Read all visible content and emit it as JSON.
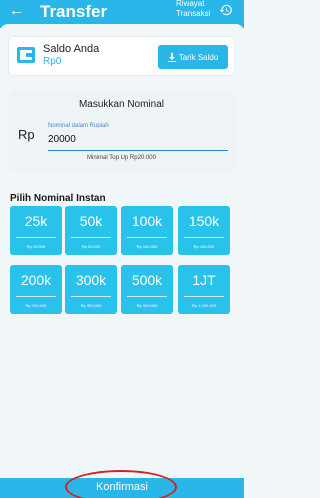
{
  "header": {
    "title": "Transfer",
    "history_label": "Riwayat\nTransaksi"
  },
  "saldo": {
    "label": "Saldo Anda",
    "value": "Rp0",
    "withdraw_button": "Tarik Saldo"
  },
  "nominal": {
    "title": "Masukkan Nominal",
    "currency": "Rp",
    "field_label": "Nominal dalam Rupiah",
    "field_value": "20000",
    "min_note": "Minimal Top Up Rp20.000"
  },
  "instant": {
    "title": "Pilih Nominal Instan",
    "tiles": [
      {
        "label": "25k",
        "amount": "Rp 25.000"
      },
      {
        "label": "50k",
        "amount": "Rp 50.000"
      },
      {
        "label": "100k",
        "amount": "Rp 100.000"
      },
      {
        "label": "150k",
        "amount": "Rp 150.000"
      },
      {
        "label": "200k",
        "amount": "Rp 200.000"
      },
      {
        "label": "300k",
        "amount": "Rp 300.000"
      },
      {
        "label": "500k",
        "amount": "Rp 500.000"
      },
      {
        "label": "1JT",
        "amount": "Rp 1.000.000"
      }
    ]
  },
  "confirm_button": "Konfirmasi",
  "colors": {
    "primary": "#29b6e8",
    "tile": "#29c2ea",
    "highlight": "#d2232a"
  },
  "icons": {
    "back": "back-arrow-icon",
    "history": "history-icon",
    "wallet": "wallet-icon",
    "download": "download-icon"
  }
}
